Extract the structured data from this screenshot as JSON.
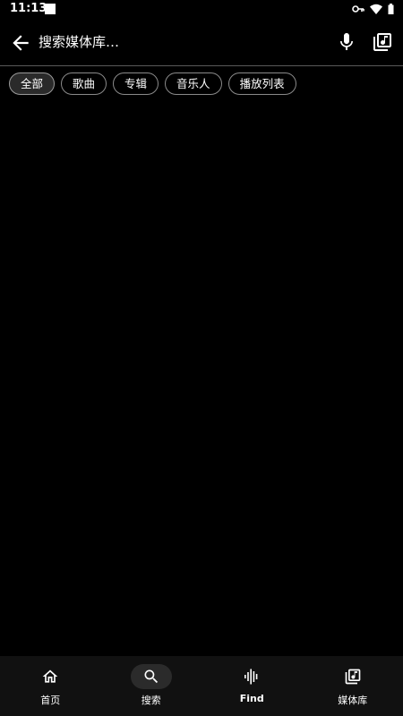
{
  "status_bar": {
    "time": "11:13",
    "icons": [
      "notification-square-icon",
      "vpn-key-icon",
      "wifi-icon",
      "battery-icon"
    ]
  },
  "search": {
    "placeholder": "搜索媒体库…",
    "value": "",
    "icons": [
      "back-arrow-icon",
      "mic-icon",
      "library-music-icon"
    ]
  },
  "filters": [
    {
      "label": "全部",
      "selected": true
    },
    {
      "label": "歌曲",
      "selected": false
    },
    {
      "label": "专辑",
      "selected": false
    },
    {
      "label": "音乐人",
      "selected": false
    },
    {
      "label": "播放列表",
      "selected": false
    }
  ],
  "bottom_nav": [
    {
      "label": "首页",
      "icon": "home-icon",
      "active": false
    },
    {
      "label": "搜索",
      "icon": "search-icon",
      "active": true
    },
    {
      "label": "Find",
      "icon": "waveform-icon",
      "active": false
    },
    {
      "label": "媒体库",
      "icon": "library-music-icon",
      "active": false
    }
  ],
  "colors": {
    "background": "#000000",
    "text": "#ffffff",
    "chip_border": "#8a8a8a",
    "chip_selected_bg": "#2a2a2a",
    "nav_bg": "#111111",
    "nav_active_pill": "#2b2b2b"
  }
}
